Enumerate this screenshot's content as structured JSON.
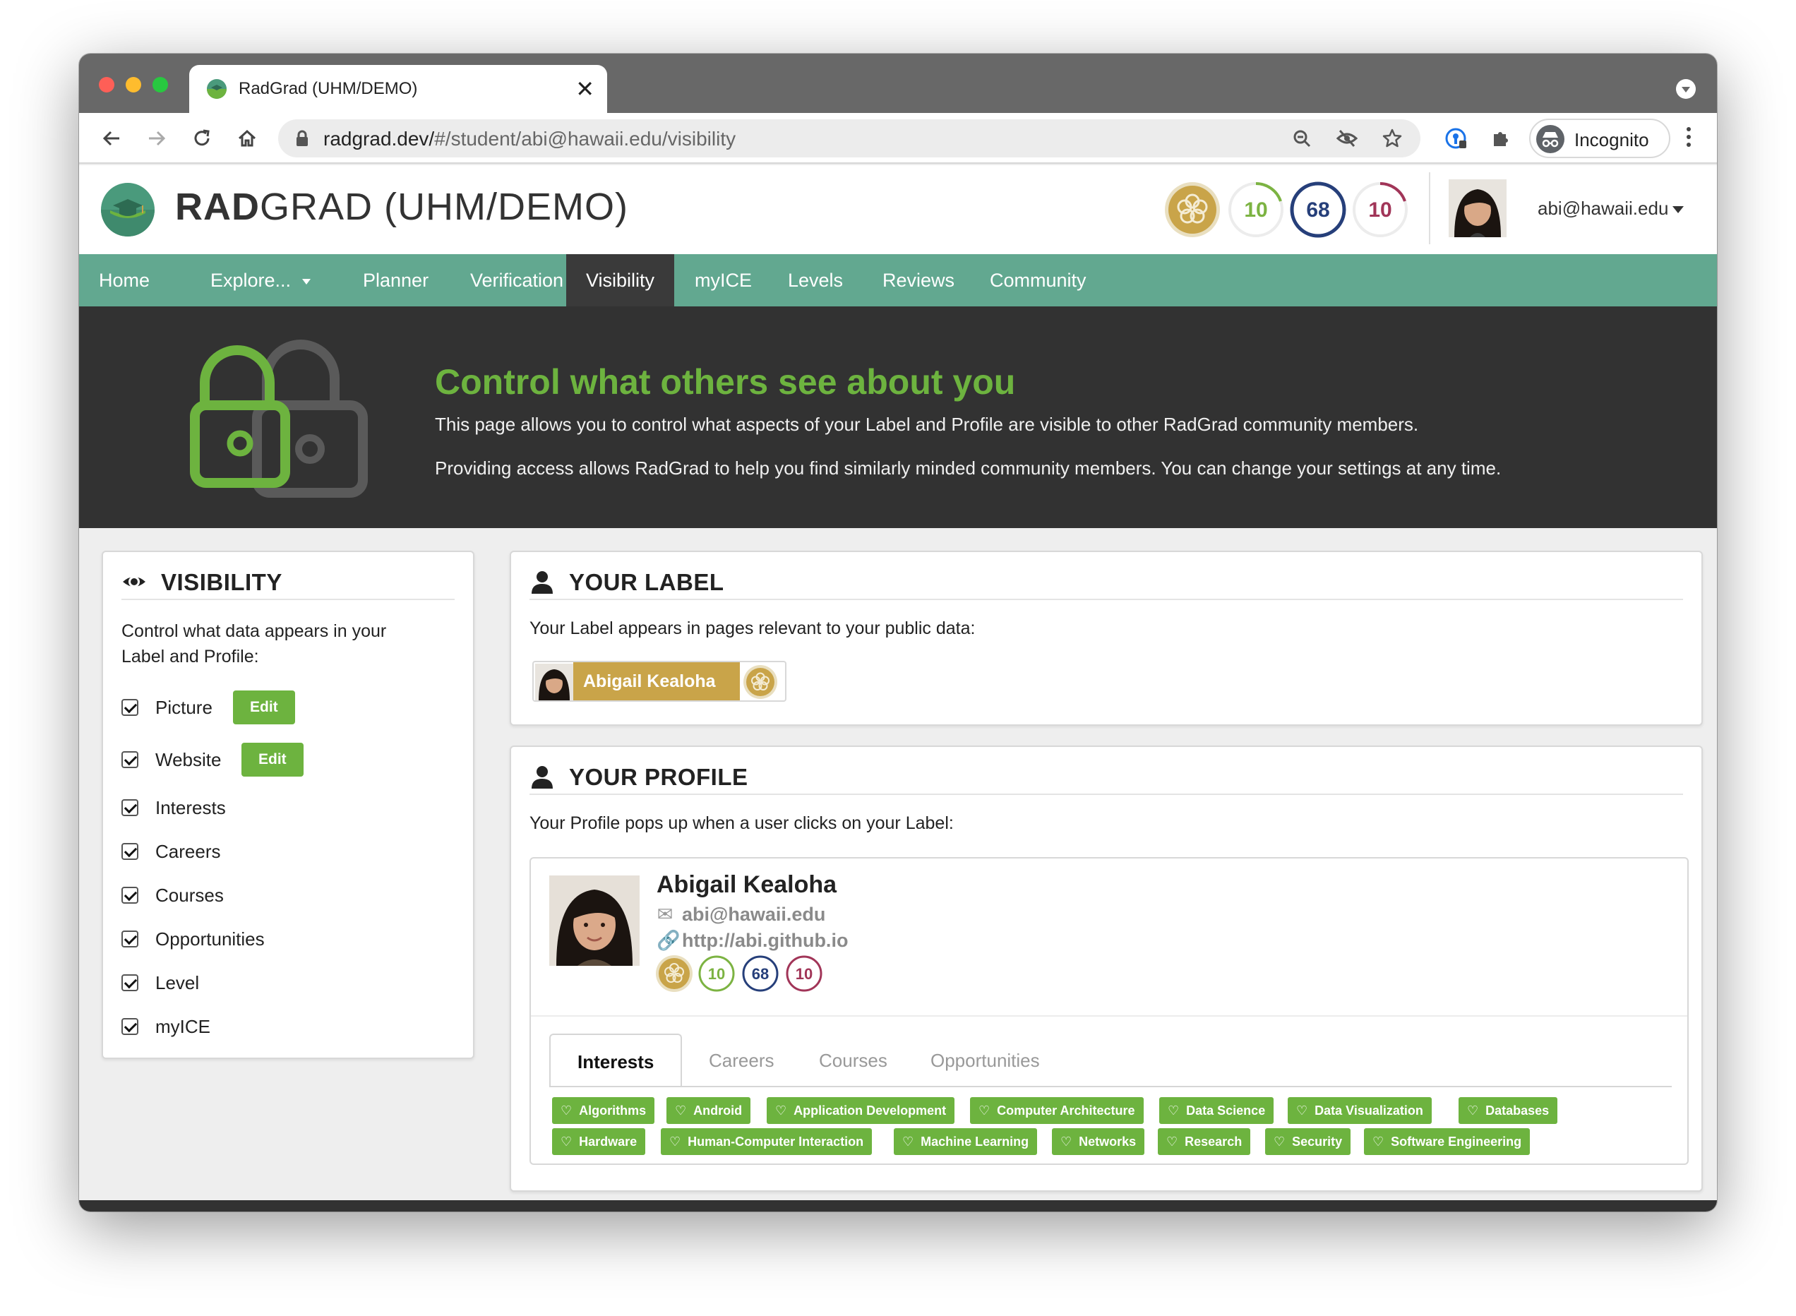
{
  "browser": {
    "tab_title": "RadGrad (UHM/DEMO)",
    "tab_close": "✕",
    "new_tab": "+",
    "url_host": "radgrad.dev/",
    "url_path": "#/student/abi@hawaii.edu/visibility",
    "incognito_label": "Incognito"
  },
  "header": {
    "title_bold": "RAD",
    "title_rest": "GRAD (UHM/DEMO)",
    "ice": {
      "innovation": "10",
      "competency": "68",
      "experience": "10"
    },
    "user_email": "abi@hawaii.edu"
  },
  "nav": {
    "items": [
      {
        "label": "Home"
      },
      {
        "label": "Explore..."
      },
      {
        "label": "Planner"
      },
      {
        "label": "Verification"
      },
      {
        "label": "Visibility"
      },
      {
        "label": "myICE"
      },
      {
        "label": "Levels"
      },
      {
        "label": "Reviews"
      },
      {
        "label": "Community"
      }
    ],
    "active": "Visibility"
  },
  "hero": {
    "title": "Control what others see about you",
    "p1": "This page allows you to control what aspects of your Label and Profile are visible to other RadGrad community members.",
    "p2": "Providing access allows RadGrad to help you find similarly minded community members. You can change your settings at any time."
  },
  "visibility": {
    "title": "VISIBILITY",
    "intro": "Control what data appears in your Label and Profile:",
    "edit_label": "Edit",
    "options": [
      {
        "label": "Picture",
        "checked": true
      },
      {
        "label": "Website",
        "checked": true
      },
      {
        "label": "Interests",
        "checked": true
      },
      {
        "label": "Careers",
        "checked": true
      },
      {
        "label": "Courses",
        "checked": true
      },
      {
        "label": "Opportunities",
        "checked": true
      },
      {
        "label": "Level",
        "checked": true
      },
      {
        "label": "myICE",
        "checked": true
      }
    ]
  },
  "your_label": {
    "title": "YOUR LABEL",
    "description": "Your Label appears in pages relevant to your public data:",
    "name": "Abigail Kealoha"
  },
  "your_profile": {
    "title": "YOUR PROFILE",
    "description": "Your Profile pops up when a user clicks on your Label:",
    "name": "Abigail Kealoha",
    "email": "abi@hawaii.edu",
    "website": "http://abi.github.io",
    "ice": {
      "innovation": "10",
      "competency": "68",
      "experience": "10"
    },
    "tabs": [
      "Interests",
      "Careers",
      "Courses",
      "Opportunities"
    ],
    "active_tab": "Interests",
    "interests_row1": [
      "Algorithms",
      "Android",
      "Application Development",
      "Computer Architecture",
      "Data Science",
      "Data Visualization",
      "Databases"
    ],
    "interests_row2": [
      "Hardware",
      "Human-Computer Interaction",
      "Machine Learning",
      "Networks",
      "Research",
      "Security",
      "Software Engineering"
    ]
  },
  "colors": {
    "nav_green": "#62a890",
    "accent_green": "#6db33f",
    "gold": "#c9a449",
    "competency_blue": "#263f7a",
    "experience_crimson": "#a13558",
    "hero_bg": "#323232"
  },
  "icons": {
    "back": "arrow-left-icon",
    "forward": "arrow-right-icon",
    "reload": "reload-icon",
    "home": "home-icon",
    "lock": "lock-icon",
    "zoom": "magnifier-icon",
    "eye_off": "eye-slash-icon",
    "star": "star-icon",
    "extension": "puzzle-icon",
    "eye": "eye-icon",
    "user": "user-icon",
    "envelope": "envelope-icon",
    "link": "link-icon",
    "heart": "heart-icon"
  }
}
